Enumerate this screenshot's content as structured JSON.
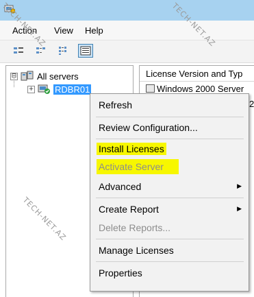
{
  "menu": {
    "items": [
      "Action",
      "View",
      "Help"
    ]
  },
  "toolbar": {
    "buttons": [
      "tree-view-icon",
      "small-icons-icon",
      "list-view-icon",
      "details-view-icon"
    ]
  },
  "tree": {
    "root_label": "All servers",
    "root_expander": "⊟",
    "child_label": "RDBR01",
    "child_expander": "+"
  },
  "list": {
    "column_header": "License Version and Typ",
    "row1": "Windows 2000 Server",
    "row2": "2"
  },
  "context_menu": {
    "refresh": "Refresh",
    "review_configuration": "Review Configuration...",
    "install_licenses": "Install Licenses",
    "activate_server": "Activate Server",
    "advanced": "Advanced",
    "create_report": "Create Report",
    "delete_reports": "Delete Reports...",
    "manage_licenses": "Manage Licenses",
    "properties": "Properties",
    "submenu_arrow": "▶"
  },
  "watermark": "TECH-NET.AZ",
  "colors": {
    "titlebar": "#a7d2f0",
    "highlight": "#f7f700",
    "selection": "#3399ff"
  }
}
